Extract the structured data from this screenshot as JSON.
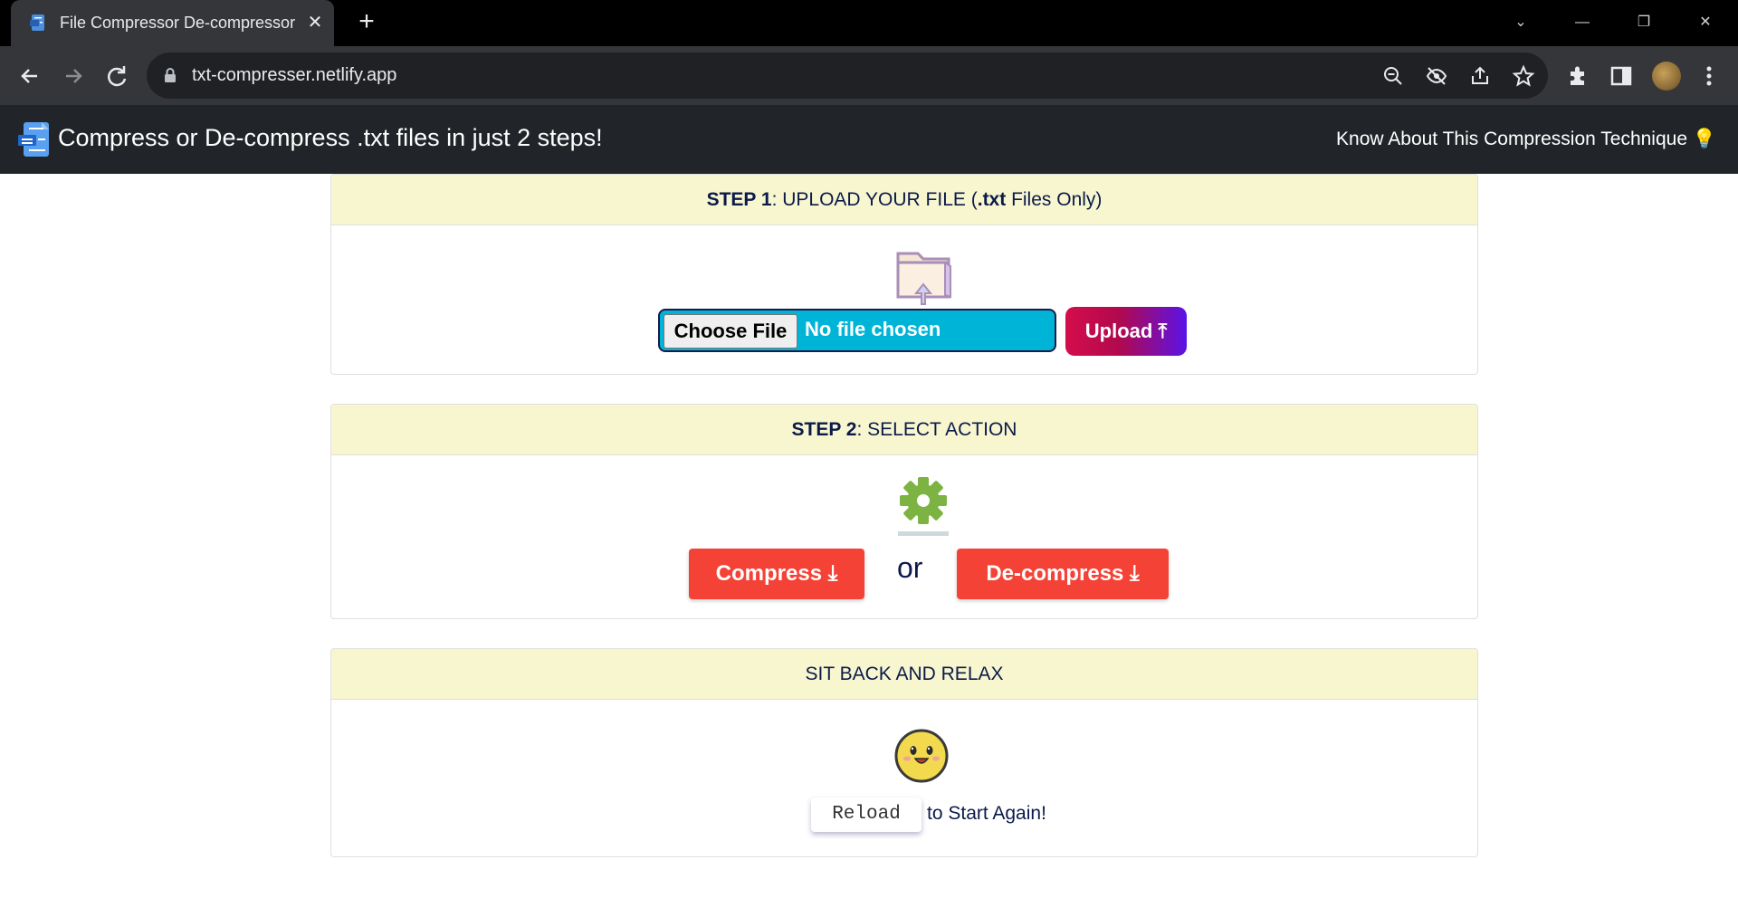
{
  "browser": {
    "tab_title": "File Compressor De-compressor",
    "tab_close": "✕",
    "new_tab": "+",
    "url": "txt-compresser.netlify.app",
    "window_controls": [
      "⌄",
      "—",
      "❐",
      "✕"
    ]
  },
  "navbar": {
    "title": "Compress or De-compress .txt files in just 2 steps!",
    "link": "Know About This Compression Technique 💡"
  },
  "step1": {
    "header_bold": "STEP 1",
    "header_text": ": UPLOAD YOUR FILE (",
    "header_ext": ".txt",
    "header_tail": " Files Only)",
    "choose_file": "Choose File",
    "no_file": "No file chosen",
    "upload": "Upload ⤒"
  },
  "step2": {
    "header_bold": "STEP 2",
    "header_text": ": SELECT ACTION",
    "compress": "Compress ⤓",
    "or": "or",
    "decompress": "De-compress ⤓"
  },
  "relax": {
    "header": "SIT BACK AND RELAX",
    "reload": "Reload",
    "restart": "to Start Again!"
  },
  "colors": {
    "header_bg": "#f8f6cf",
    "action_red": "#f44336",
    "input_cyan": "#00b4d8",
    "navbar_dark": "#212529"
  }
}
